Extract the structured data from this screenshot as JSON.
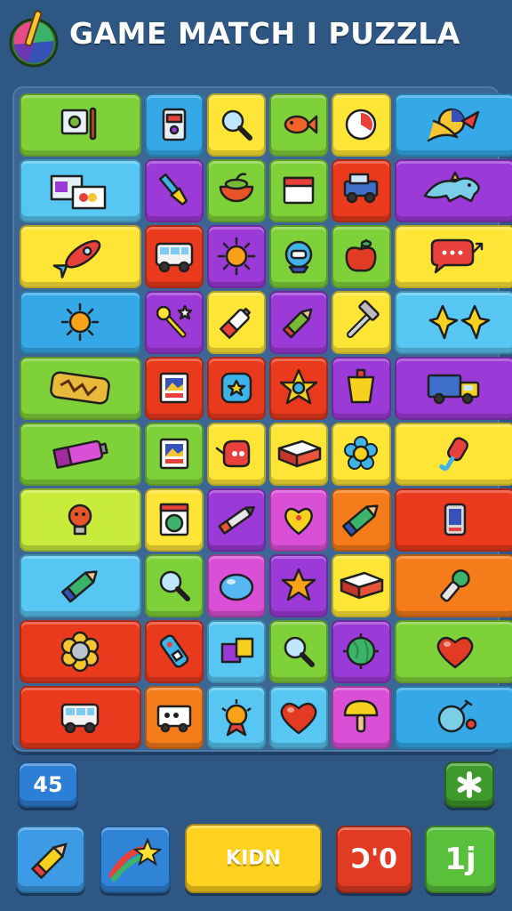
{
  "header": {
    "title": "GAME MATCH I PUZZLA",
    "logo_icon": "paintbrush-globe-icon"
  },
  "colors": {
    "background": "#2f5784",
    "board": "#3c6794",
    "green": "#7fd13a",
    "blue": "#35a9e8",
    "yellow": "#ffe535",
    "purple": "#9b3ad6",
    "red": "#ea3a1e",
    "orange": "#f47c1a",
    "lime": "#c7ec3c",
    "skyblue": "#57c6f2",
    "magenta": "#d94fd6"
  },
  "board": {
    "rows": [
      [
        {
          "icon": "picture-easel-icon",
          "color": "green",
          "span": 2
        },
        {
          "icon": "phone-card-icon",
          "color": "blue",
          "span": 1
        },
        {
          "icon": "magnifier-icon",
          "color": "yellow",
          "span": 1
        },
        {
          "icon": "fish-icon",
          "color": "green",
          "span": 1
        },
        {
          "icon": "clock-icon",
          "color": "yellow",
          "span": 1
        },
        {
          "icon": "fish-ball-icon",
          "color": "blue",
          "span": 2
        }
      ],
      [
        {
          "icon": "photo-cards-icon",
          "color": "skyblue",
          "span": 2
        },
        {
          "icon": "paintbrush-icon",
          "color": "purple",
          "span": 1
        },
        {
          "icon": "bowl-icon",
          "color": "green",
          "span": 1
        },
        {
          "icon": "calendar-icon",
          "color": "green",
          "span": 1
        },
        {
          "icon": "jeep-icon",
          "color": "red",
          "span": 1
        },
        {
          "icon": "dinosaur-icon",
          "color": "purple",
          "span": 2
        }
      ],
      [
        {
          "icon": "rocket-icon",
          "color": "yellow",
          "span": 2
        },
        {
          "icon": "bus-icon",
          "color": "red",
          "span": 1
        },
        {
          "icon": "sun-icon",
          "color": "purple",
          "span": 1
        },
        {
          "icon": "robot-helmet-icon",
          "color": "green",
          "span": 1
        },
        {
          "icon": "apple-icon",
          "color": "green",
          "span": 1
        },
        {
          "icon": "speech-bubble-icon",
          "color": "yellow",
          "span": 2
        }
      ],
      [
        {
          "icon": "sun-icon",
          "color": "blue",
          "span": 2
        },
        {
          "icon": "magic-wand-icon",
          "color": "purple",
          "span": 1
        },
        {
          "icon": "battery-icon",
          "color": "yellow",
          "span": 1
        },
        {
          "icon": "marker-icon",
          "color": "purple",
          "span": 1
        },
        {
          "icon": "hammer-icon",
          "color": "yellow",
          "span": 1
        },
        {
          "icon": "stars-icon",
          "color": "skyblue",
          "span": 2
        }
      ],
      [
        {
          "icon": "sign-plate-icon",
          "color": "green",
          "span": 2
        },
        {
          "icon": "photo-frame-icon",
          "color": "red",
          "span": 1
        },
        {
          "icon": "blue-square-icon",
          "color": "red",
          "span": 1
        },
        {
          "icon": "star-badge-icon",
          "color": "red",
          "span": 1
        },
        {
          "icon": "cup-icon",
          "color": "purple",
          "span": 1
        },
        {
          "icon": "truck-icon",
          "color": "purple",
          "span": 2
        }
      ],
      [
        {
          "icon": "battery-roll-icon",
          "color": "green",
          "span": 2
        },
        {
          "icon": "photo-frame-icon",
          "color": "green",
          "span": 1
        },
        {
          "icon": "teapot-icon",
          "color": "yellow",
          "span": 1
        },
        {
          "icon": "box-icon",
          "color": "yellow",
          "span": 1
        },
        {
          "icon": "flower-icon",
          "color": "yellow",
          "span": 1
        },
        {
          "icon": "popsicle-icon",
          "color": "yellow",
          "span": 2
        }
      ],
      [
        {
          "icon": "lightbulb-icon",
          "color": "lime",
          "span": 2
        },
        {
          "icon": "washing-machine-icon",
          "color": "yellow",
          "span": 1
        },
        {
          "icon": "pen-icon",
          "color": "purple",
          "span": 1
        },
        {
          "icon": "heart-badge-icon",
          "color": "magenta",
          "span": 1
        },
        {
          "icon": "crayon-icon",
          "color": "orange",
          "span": 1
        },
        {
          "icon": "phone-icon",
          "color": "red",
          "span": 2
        }
      ],
      [
        {
          "icon": "crayon-icon",
          "color": "skyblue",
          "span": 2
        },
        {
          "icon": "magnifier-icon",
          "color": "green",
          "span": 1
        },
        {
          "icon": "water-drop-icon",
          "color": "magenta",
          "span": 1
        },
        {
          "icon": "star-icon",
          "color": "purple",
          "span": 1
        },
        {
          "icon": "box-icon",
          "color": "yellow",
          "span": 1
        },
        {
          "icon": "microphone-icon",
          "color": "orange",
          "span": 2
        }
      ],
      [
        {
          "icon": "flower-gem-icon",
          "color": "red",
          "span": 2
        },
        {
          "icon": "remote-icon",
          "color": "red",
          "span": 1
        },
        {
          "icon": "cubes-icon",
          "color": "skyblue",
          "span": 1
        },
        {
          "icon": "magnifier-icon",
          "color": "green",
          "span": 1
        },
        {
          "icon": "globe-icon",
          "color": "purple",
          "span": 1
        },
        {
          "icon": "heart-icon",
          "color": "green",
          "span": 2
        }
      ],
      [
        {
          "icon": "bus-icon",
          "color": "red",
          "span": 2
        },
        {
          "icon": "cart-icon",
          "color": "orange",
          "span": 1
        },
        {
          "icon": "sun-medal-icon",
          "color": "skyblue",
          "span": 1
        },
        {
          "icon": "heart-icon",
          "color": "skyblue",
          "span": 1
        },
        {
          "icon": "mushroom-icon",
          "color": "magenta",
          "span": 1
        },
        {
          "icon": "bomb-icon",
          "color": "blue",
          "span": 2
        }
      ]
    ]
  },
  "status": {
    "moves_label": "45",
    "asterisk_icon": "asterisk-icon"
  },
  "bottom_bar": {
    "pencil_icon": "pencil-icon",
    "star_icon": "shooting-star-icon",
    "kidn_label": "KIDN",
    "score_label": "Ɔ'0",
    "level_label": "1j"
  }
}
